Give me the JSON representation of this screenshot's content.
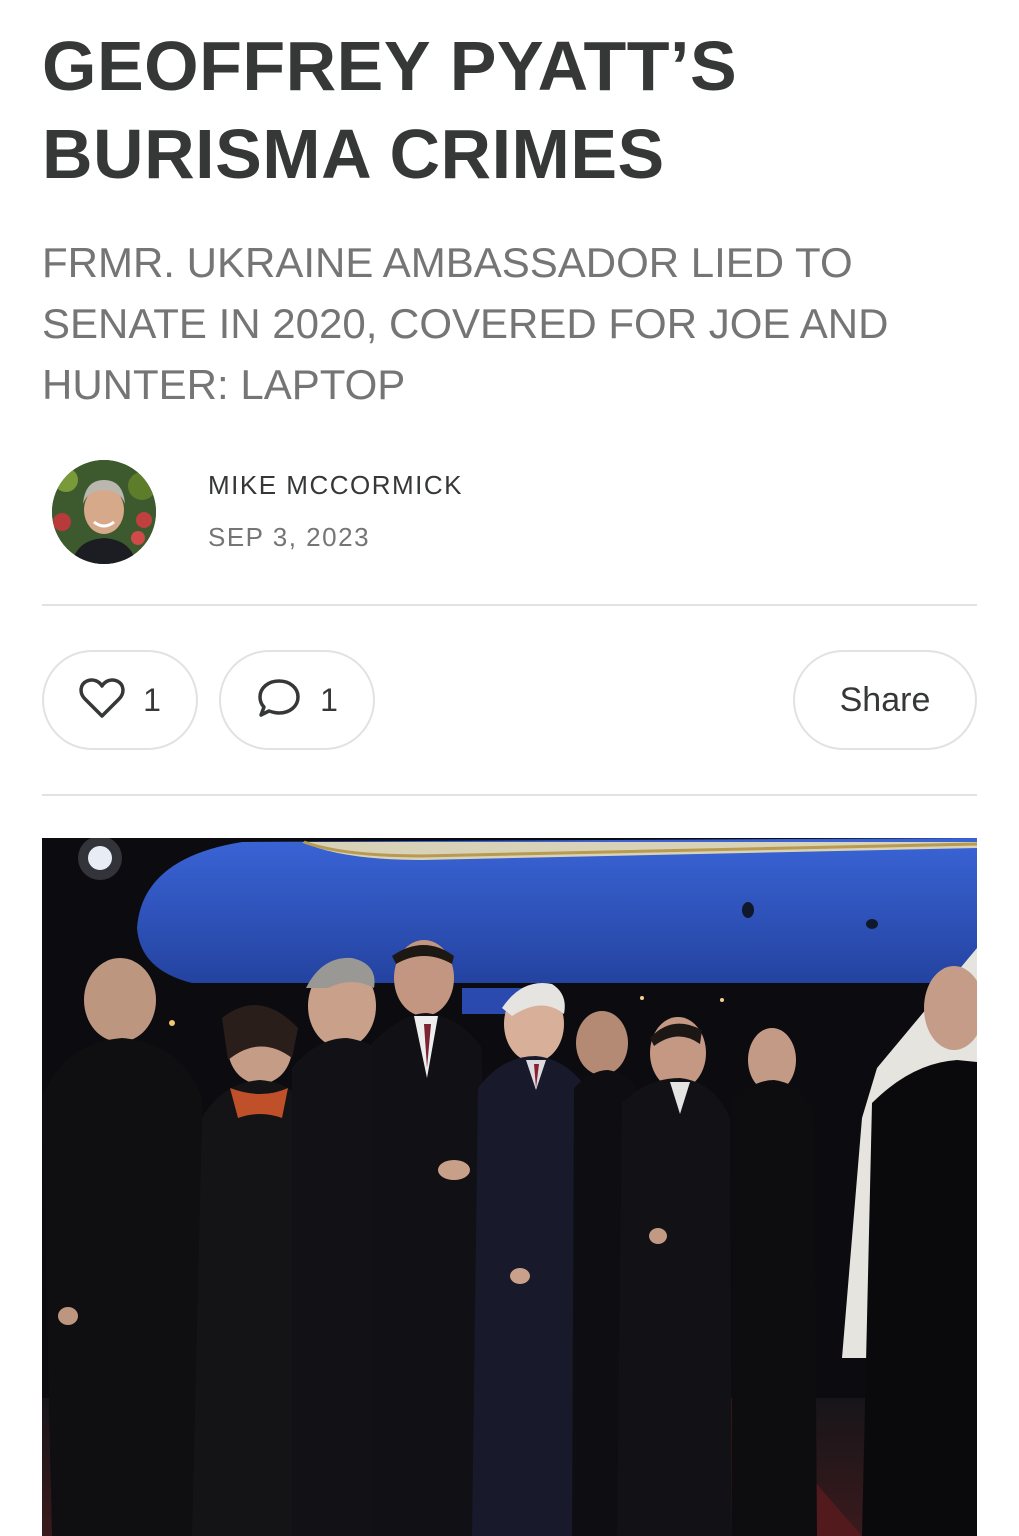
{
  "post": {
    "title": "GEOFFREY PYATT’S BURISMA CRIMES",
    "subtitle": "FRMR. UKRAINE AMBASSADOR LIED TO SENATE IN 2020, COVERED FOR JOE AND HUNTER: LAPTOP"
  },
  "byline": {
    "author": "MIKE MCCORMICK",
    "date": "SEP 3, 2023",
    "avatar_icon": "author-avatar"
  },
  "actions": {
    "like_icon": "heart-icon",
    "like_count": "1",
    "comment_icon": "comment-bubble-icon",
    "comment_count": "1",
    "share_label": "Share"
  },
  "colors": {
    "text_dark": "#363737",
    "text_muted": "#757575",
    "border": "#e2e2e2",
    "plane_blue": "#2f56c6"
  }
}
